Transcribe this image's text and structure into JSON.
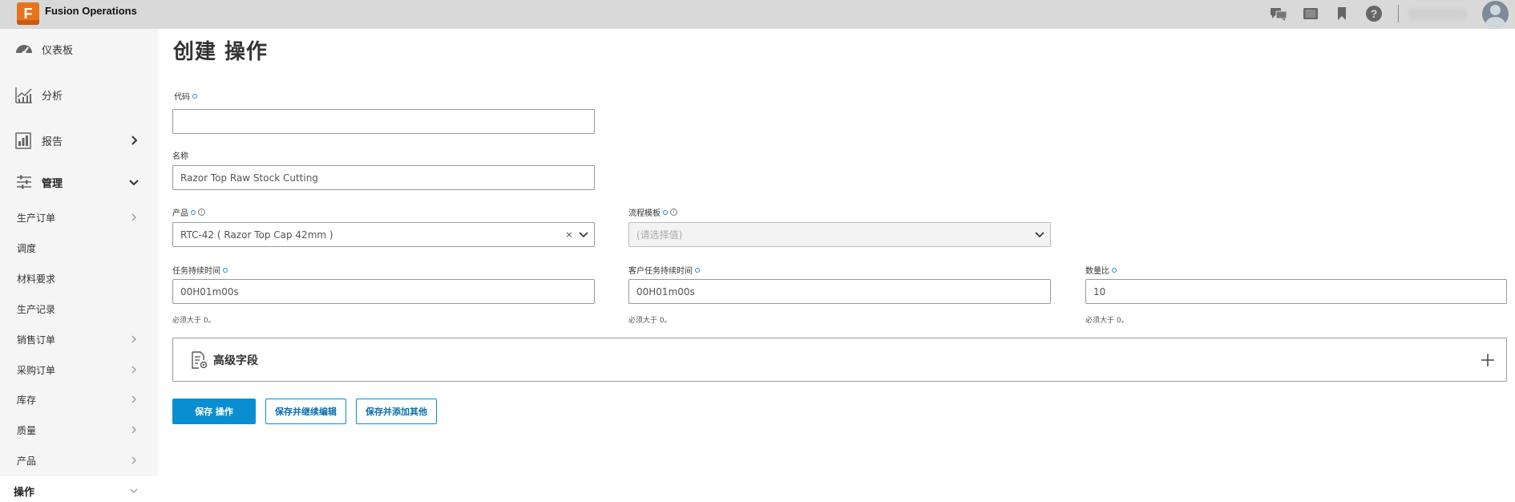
{
  "app": {
    "logo_letter": "F",
    "title": "Fusion Operations"
  },
  "topbar": {
    "icons": [
      "chat-icon",
      "tablet-icon",
      "bookmark-icon",
      "help-icon"
    ],
    "help_glyph": "?"
  },
  "sidebar": {
    "main_items": [
      {
        "label": "仪表板",
        "icon": "dashboard-icon"
      },
      {
        "label": "分析",
        "icon": "analytics-icon"
      },
      {
        "label": "报告",
        "icon": "report-icon"
      },
      {
        "label": "管理",
        "icon": "manage-icon"
      }
    ],
    "sub_items": [
      {
        "label": "生产订单",
        "has_chevron": true
      },
      {
        "label": "调度",
        "has_chevron": false
      },
      {
        "label": "材料要求",
        "has_chevron": false
      },
      {
        "label": "生产记录",
        "has_chevron": false
      },
      {
        "label": "销售订单",
        "has_chevron": true
      },
      {
        "label": "采购订单",
        "has_chevron": true
      },
      {
        "label": "库存",
        "has_chevron": true
      },
      {
        "label": "质量",
        "has_chevron": true
      },
      {
        "label": "产品",
        "has_chevron": true
      },
      {
        "label": "操作",
        "has_chevron": true,
        "active": true
      }
    ]
  },
  "page": {
    "title": "创建 操作"
  },
  "form": {
    "code": {
      "label": "代码",
      "value": ""
    },
    "name": {
      "label": "名称",
      "value": "Razor Top Raw Stock Cutting"
    },
    "product": {
      "label": "产品",
      "value": "RTC-42 ( Razor Top Cap 42mm )",
      "clear_glyph": "×"
    },
    "process_template": {
      "label": "流程模板",
      "placeholder": "(请选择值)"
    },
    "task_duration": {
      "label": "任务持续时间",
      "value": "00H01m00s",
      "hint": "必须大于 0。"
    },
    "customer_task_duration": {
      "label": "客户任务持续时间",
      "value": "00H01m00s",
      "hint": "必须大于 0。"
    },
    "quantity_ratio": {
      "label": "数量比",
      "value": "10",
      "hint": "必须大于 0。"
    },
    "info_glyph": "i"
  },
  "advanced": {
    "label": "高级字段"
  },
  "actions": {
    "save": "保存 操作",
    "save_continue": "保存并继续编辑",
    "save_add": "保存并添加其他"
  },
  "colors": {
    "accent": "#0a8ed2",
    "brand": "#e8731b",
    "topbar": "#d9d9d9",
    "sidebar": "#f5f5f5"
  }
}
